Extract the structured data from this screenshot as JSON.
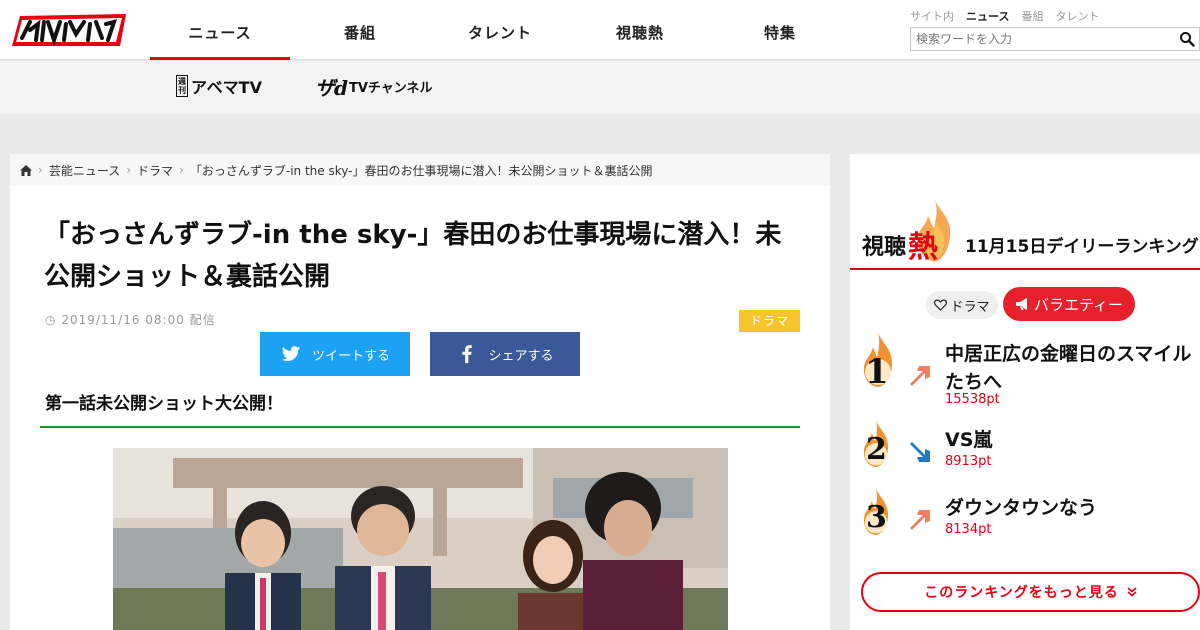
{
  "header": {
    "nav": [
      "ニュース",
      "番組",
      "タレント",
      "視聴熱",
      "特集"
    ],
    "scope": [
      "サイト内",
      "ニュース",
      "番組",
      "タレント"
    ],
    "search_placeholder": "検索ワードを入力"
  },
  "subnav": {
    "abema_tag": "週刊",
    "abema_label": "アベマTV",
    "dtv_label": "TVチャンネル"
  },
  "breadcrumb": {
    "items": [
      "芸能ニュース",
      "ドラマ",
      "「おっさんずラブ-in the sky-」春田のお仕事現場に潜入！未公開ショット＆裏話公開"
    ]
  },
  "article": {
    "title": "「おっさんずラブ-in the sky-」春田のお仕事現場に潜入！未公開ショット＆裏話公開",
    "date": "2019/11/16 08:00 配信",
    "genre": "ドラマ",
    "tweet_label": "ツイートする",
    "share_label": "シェアする",
    "subheading": "第一話未公開ショット大公開！"
  },
  "ranking": {
    "title_a": "視聴",
    "title_b": "熱",
    "title_c": "11月15日デイリーランキング",
    "tabs": [
      "ドラマ",
      "バラエティー"
    ],
    "items": [
      {
        "rank": "1",
        "title": "中居正広の金曜日のスマイルたちへ",
        "points": "15538pt",
        "trend": "up"
      },
      {
        "rank": "2",
        "title": "VS嵐",
        "points": "8913pt",
        "trend": "down"
      },
      {
        "rank": "3",
        "title": "ダウンタウンなう",
        "points": "8134pt",
        "trend": "up"
      }
    ],
    "more_label": "このランキングをもっと見る"
  },
  "colors": {
    "brand_red": "#e60012",
    "twitter": "#1da1f2",
    "facebook": "#3b5998",
    "genre_yellow": "#f5c52b",
    "section_green": "#1a9a2a"
  }
}
